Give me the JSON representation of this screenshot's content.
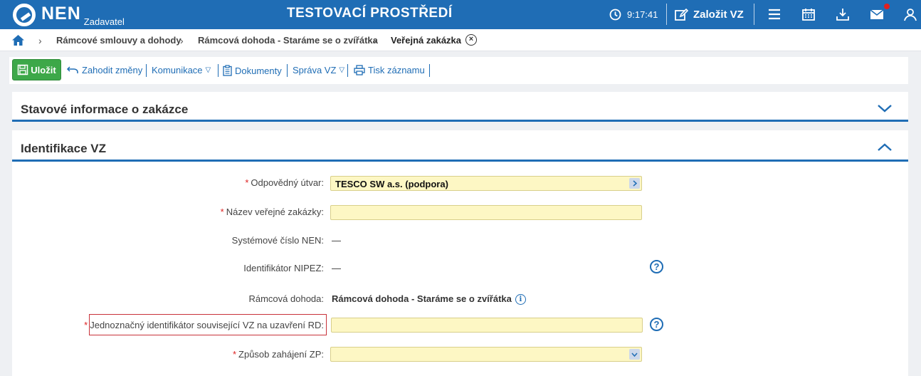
{
  "header": {
    "logo": "NEN",
    "logo_sub": "Zadavatel",
    "env_title": "TESTOVACÍ PROSTŘEDÍ",
    "clock": "9:17:41",
    "create_label": "Založit VZ",
    "icons": [
      "clock-icon",
      "edit-icon",
      "menu-icon",
      "calendar-icon",
      "download-icon",
      "mail-icon",
      "user-icon"
    ],
    "accent_color": "#1f6db5",
    "notification_color": "#e02020"
  },
  "breadcrumb": {
    "items": [
      "Rámcové smlouvy a dohody",
      "Rámcová dohoda - Staráme se o zvířátka",
      "Veřejná zakázka"
    ]
  },
  "toolbar": {
    "save_label": "Uložit",
    "discard_label": "Zahodit změny",
    "communication_label": "Komunikace",
    "documents_label": "Dokumenty",
    "manage_label": "Správa VZ",
    "print_label": "Tisk záznamu",
    "save_color": "#3da849"
  },
  "panels": {
    "status_title": "Stavové informace o zakázce",
    "identification_title": "Identifikace VZ"
  },
  "form": {
    "responsible_unit": {
      "label": "Odpovědný útvar:",
      "value": "TESCO SW a.s. (podpora)"
    },
    "name": {
      "label": "Název veřejné zakázky:",
      "value": ""
    },
    "system_number": {
      "label": "Systémové číslo NEN:",
      "value": "—"
    },
    "nipez_id": {
      "label": "Identifikátor NIPEZ:",
      "value": "—"
    },
    "framework": {
      "label": "Rámcová dohoda:",
      "value": "Rámcová dohoda - Staráme se o zvířátka"
    },
    "unique_id": {
      "label": "Jednoznačný identifikátor související VZ na uzavření RD:",
      "value": ""
    },
    "start_method": {
      "label": "Způsob zahájení ZP:",
      "value": ""
    },
    "required_mark": "*",
    "help_glyph": "?",
    "info_glyph": "i",
    "field_color": "#fdf7c4"
  }
}
